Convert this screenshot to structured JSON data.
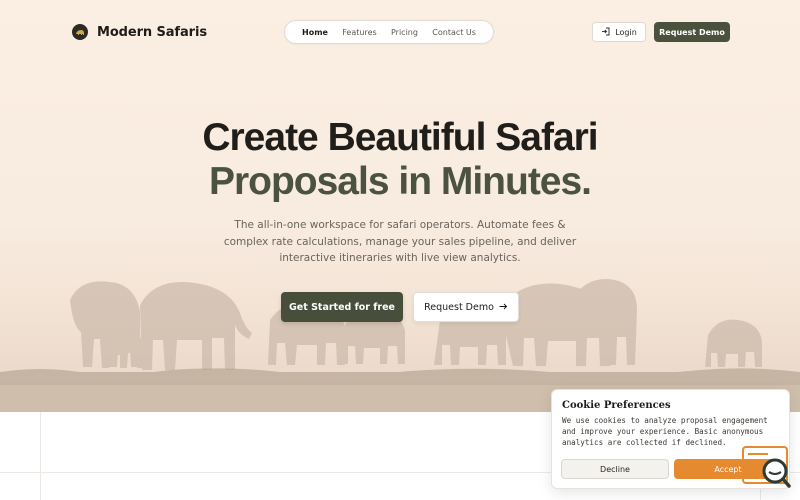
{
  "brand": {
    "name": "Modern Safaris",
    "logo_icon": "elephant-logo-icon"
  },
  "nav": {
    "links": [
      {
        "label": "Home",
        "active": true
      },
      {
        "label": "Features",
        "active": false
      },
      {
        "label": "Pricing",
        "active": false
      },
      {
        "label": "Contact Us",
        "active": false
      }
    ],
    "login_label": "Login",
    "login_icon": "login-arrow-icon",
    "request_demo_label": "Request Demo"
  },
  "hero": {
    "headline_line1": "Create Beautiful Safari",
    "headline_line2": "Proposals in Minutes.",
    "subtitle": "The all-in-one workspace for safari operators. Automate fees & complex rate calculations, manage your sales pipeline, and deliver interactive itineraries with live view analytics.",
    "cta_primary": "Get Started for free",
    "cta_secondary": "Request Demo",
    "cta_secondary_icon": "arrow-right-icon",
    "background": "elephant-herd-silhouette"
  },
  "cookie": {
    "title": "Cookie Preferences",
    "text": "We use cookies to analyze proposal engagement and improve your experience. Basic anonymous analytics are collected if declined.",
    "decline_label": "Decline",
    "accept_label": "Accept"
  },
  "colors": {
    "accent_dark": "#474e3c",
    "headline_second_line": "#4c5240",
    "cookie_accept": "#e58a2e",
    "hero_background": "#fbeee3"
  }
}
